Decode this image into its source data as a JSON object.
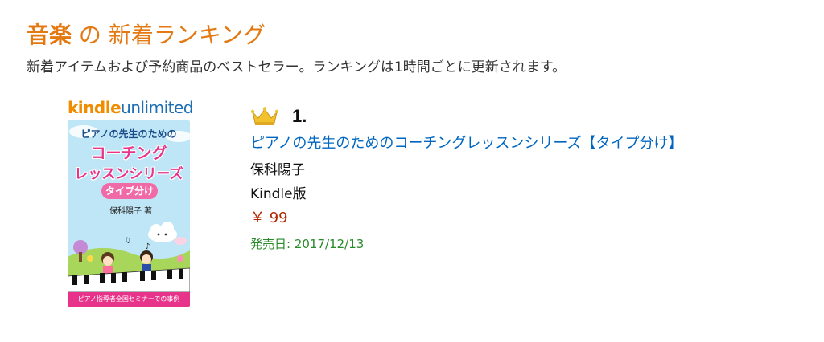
{
  "header": {
    "category": "音楽",
    "title_rest": " の 新着ランキング",
    "subtitle": "新着アイテムおよび予約商品のベストセラー。ランキングは1時間ごとに更新されます。"
  },
  "colors": {
    "title_orange": "#e47911",
    "link_blue": "#0066c0",
    "price_red": "#b12704",
    "release_green": "#2a8a2a"
  },
  "item": {
    "rank": "1.",
    "rank_icon": "crown-icon",
    "title": "ピアノの先生のためのコーチングレッスンシリーズ【タイプ分け】",
    "author": "保科陽子",
    "format": "Kindle版",
    "price": "￥ 99",
    "release": "発売日: 2017/12/13",
    "cover": {
      "logo_part1": "kindle",
      "logo_part2": "unlimited",
      "title_line1": "ピアノの先生のための",
      "title_line2": "コーチング",
      "title_line3": "レッスンシリーズ",
      "badge": "タイプ分け",
      "author": "保科陽子 著",
      "footer": "ピアノ指導者全国セミナーでの事例"
    }
  }
}
